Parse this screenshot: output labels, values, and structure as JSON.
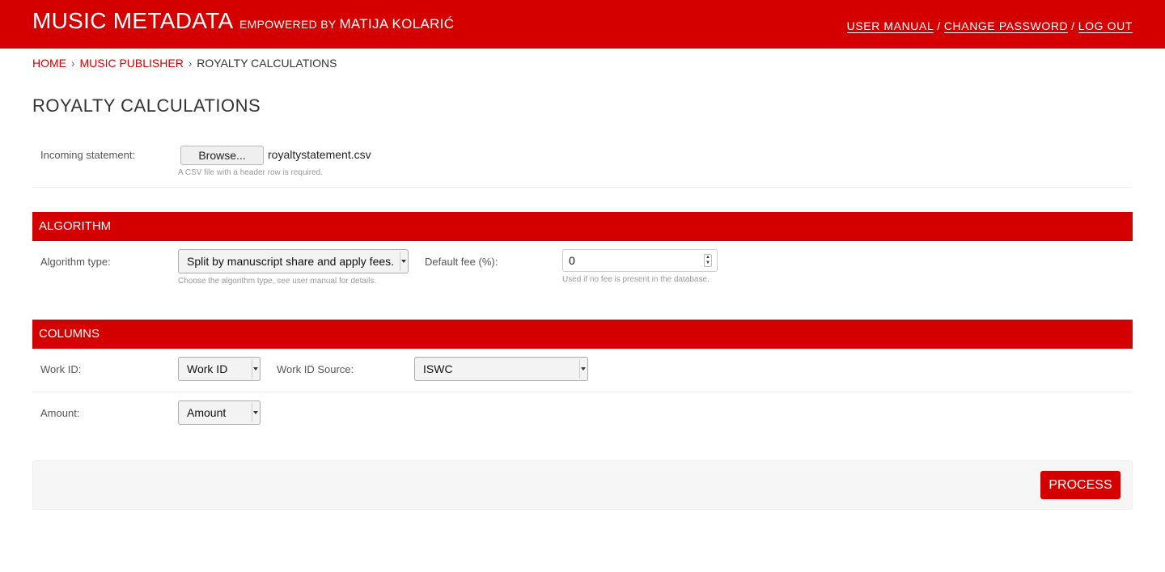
{
  "header": {
    "brand": "MUSIC METADATA",
    "empowered_by": "EMPOWERED BY",
    "author": "MATIJA KOLARIĆ",
    "links": {
      "user_manual": "USER MANUAL",
      "change_password": "CHANGE PASSWORD",
      "log_out": "LOG OUT",
      "separator": "/"
    }
  },
  "breadcrumbs": {
    "home": "HOME",
    "music_publisher": "MUSIC PUBLISHER",
    "current": "ROYALTY CALCULATIONS",
    "separator": "›"
  },
  "page_title": "ROYALTY CALCULATIONS",
  "statement": {
    "label": "Incoming statement:",
    "browse_label": "Browse...",
    "filename": "royaltystatement.csv",
    "help": "A CSV file with a header row is required."
  },
  "algorithm": {
    "section_title": "ALGORITHM",
    "type_label": "Algorithm type:",
    "type_value": "Split by manuscript share and apply fees.",
    "type_help": "Choose the algorithm type, see user manual for details.",
    "fee_label": "Default fee (%):",
    "fee_value": "0",
    "fee_help": "Used if no fee is present in the database."
  },
  "columns": {
    "section_title": "COLUMNS",
    "work_id_label": "Work ID:",
    "work_id_value": "Work ID",
    "work_id_source_label": "Work ID Source:",
    "work_id_source_value": "ISWC",
    "amount_label": "Amount:",
    "amount_value": "Amount"
  },
  "actions": {
    "process_label": "PROCESS"
  },
  "colors": {
    "brand_red": "#d40000",
    "link_red": "#cc0000"
  }
}
